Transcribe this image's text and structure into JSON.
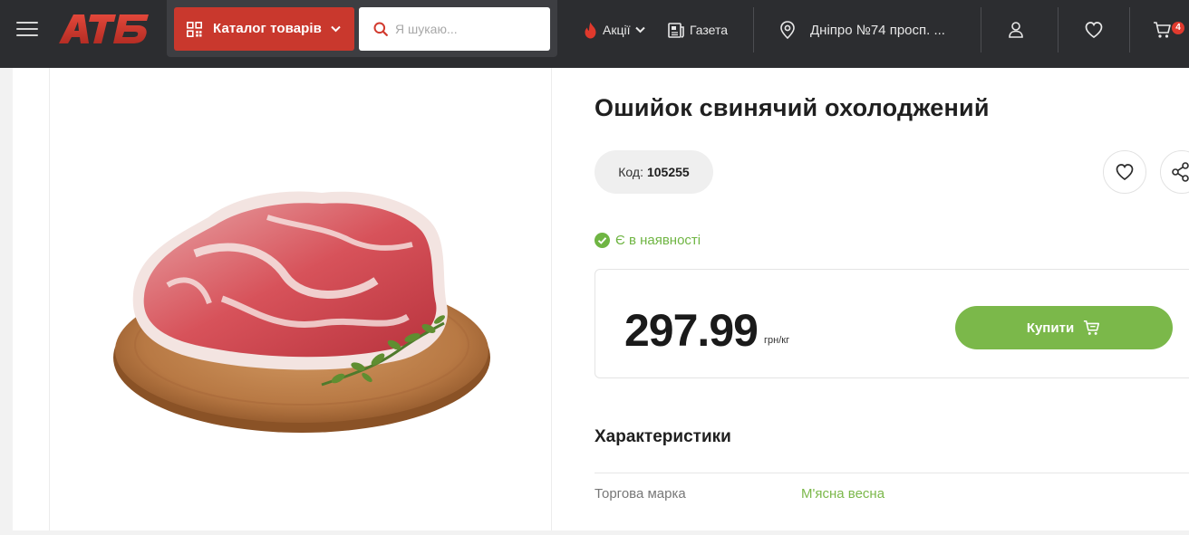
{
  "header": {
    "logo_text": "АТБ",
    "catalog_label": "Каталог товарів",
    "search_placeholder": "Я шукаю...",
    "promo_label": "Акції",
    "newspaper_label": "Газета",
    "store_label": "Дніпро №74 просп. ...",
    "cart_count": "4"
  },
  "product": {
    "title": "Ошийок свинячий охолоджений",
    "code_label": "Код:",
    "code_value": "105255",
    "stock_text": "Є в наявності",
    "price": "297.99",
    "unit": "грн/кг",
    "buy_label": "Купити"
  },
  "characteristics": {
    "title": "Характеристики",
    "rows": [
      {
        "label": "Торгова марка",
        "value": "М'ясна весна"
      }
    ]
  },
  "colors": {
    "header_bg": "#2c2d30",
    "brand_red": "#c9382d",
    "accent_green": "#7bb84a"
  }
}
